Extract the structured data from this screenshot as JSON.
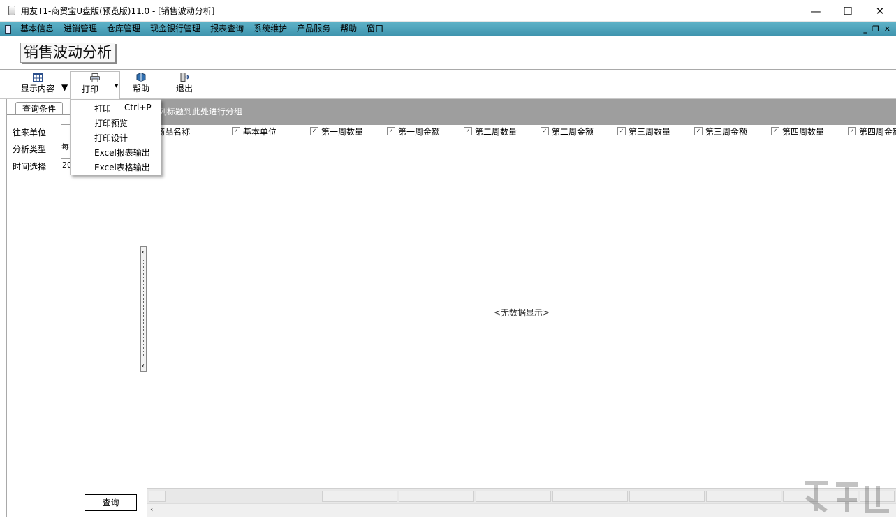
{
  "window": {
    "title": "用友T1-商贸宝U盘版(预览版)11.0 - [销售波动分析]",
    "minimize": "—",
    "maximize": "☐",
    "close": "✕"
  },
  "menubar": {
    "items": [
      "基本信息",
      "进销管理",
      "仓库管理",
      "现金银行管理",
      "报表查询",
      "系统维护",
      "产品服务",
      "帮助",
      "窗口"
    ],
    "mdi_minimize": "_",
    "mdi_restore": "❐",
    "mdi_close": "✕"
  },
  "page": {
    "title": "销售波动分析"
  },
  "toolbar": {
    "display_label": "显示内容",
    "print_label": "打印",
    "help_label": "帮助",
    "exit_label": "退出"
  },
  "print_menu": {
    "items": [
      {
        "label": "打印",
        "shortcut": "Ctrl+P"
      },
      {
        "label": "打印预览",
        "shortcut": ""
      },
      {
        "label": "打印设计",
        "shortcut": ""
      },
      {
        "label": "Excel报表输出",
        "shortcut": ""
      },
      {
        "label": "Excel表格输出",
        "shortcut": ""
      }
    ]
  },
  "left_panel": {
    "tab_label": "查询条件",
    "fields": [
      {
        "label": "往来单位",
        "value": ""
      },
      {
        "label": "分析类型",
        "value": "每"
      },
      {
        "label": "时间选择",
        "value": "20"
      }
    ],
    "query_button": "查询"
  },
  "grid": {
    "group_hint": "动列标题到此处进行分组",
    "columns": [
      "商品名称",
      "基本单位",
      "第一周数量",
      "第一周金额",
      "第二周数量",
      "第二周金额",
      "第三周数量",
      "第三周金额",
      "第四周数量",
      "第四周金额"
    ],
    "empty_text": "<无数据显示>"
  },
  "colors": {
    "menubar": "#4aa3bc",
    "group_panel": "#9e9e9e"
  }
}
